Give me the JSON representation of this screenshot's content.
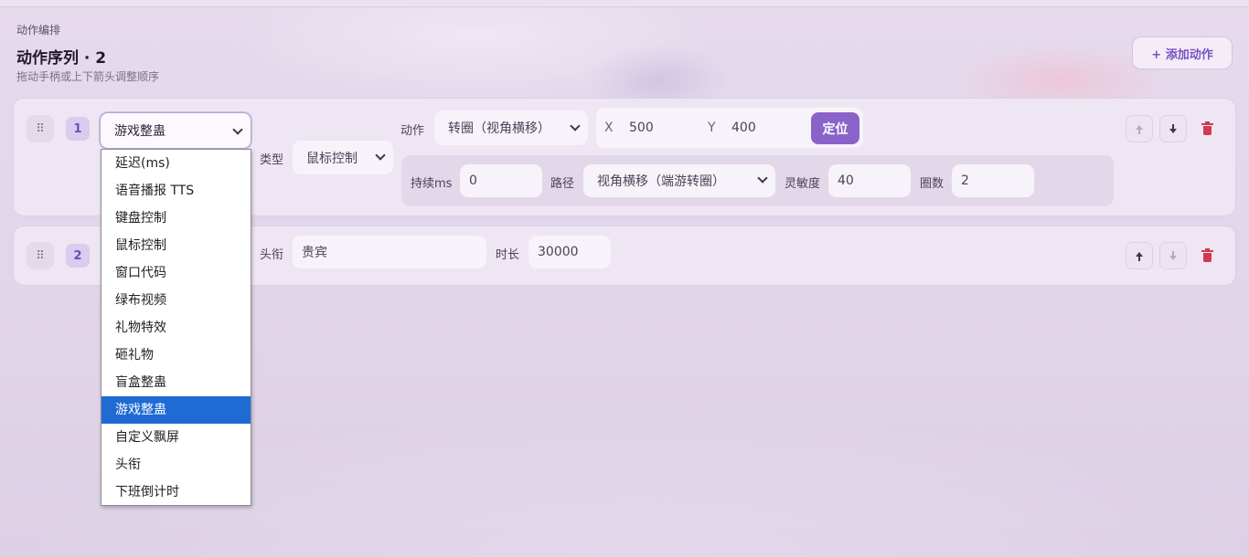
{
  "header": {
    "eyebrow": "动作编排",
    "title": "动作序列 · 2",
    "subtitle": "拖动手柄或上下箭头调整顺序",
    "add_button": "+ 添加动作"
  },
  "rows": [
    {
      "index": "1",
      "handle_icon": "⠿",
      "type_value": "游戏整蛊",
      "action_label": "动作",
      "action_value": "转圈（视角横移）",
      "x_label": "X",
      "x_value": "500",
      "y_label": "Y",
      "y_value": "400",
      "locate_button": "定位",
      "kind_label": "类型",
      "kind_value": "鼠标控制",
      "duration_label": "持续ms",
      "duration_value": "0",
      "path_label": "路径",
      "path_value": "视角横移（端游转圈）",
      "sensitivity_label": "灵敏度",
      "sensitivity_value": "40",
      "laps_label": "圈数",
      "laps_value": "2"
    },
    {
      "index": "2",
      "handle_icon": "⠿",
      "title_label": "头衔",
      "title_value": "贵宾",
      "duration_label": "时长",
      "duration_value": "30000"
    }
  ],
  "dropdown": {
    "options": [
      "延迟(ms)",
      "语音播报 TTS",
      "键盘控制",
      "鼠标控制",
      "窗口代码",
      "绿布视频",
      "礼物特效",
      "砸礼物",
      "盲盒整蛊",
      "游戏整蛊",
      "自定义飘屏",
      "头衔",
      "下班倒计时"
    ],
    "selected": "游戏整蛊"
  },
  "colors": {
    "accent": "#8a63c9",
    "danger": "#d13a4e",
    "selected_option": "#1f6bd3"
  }
}
